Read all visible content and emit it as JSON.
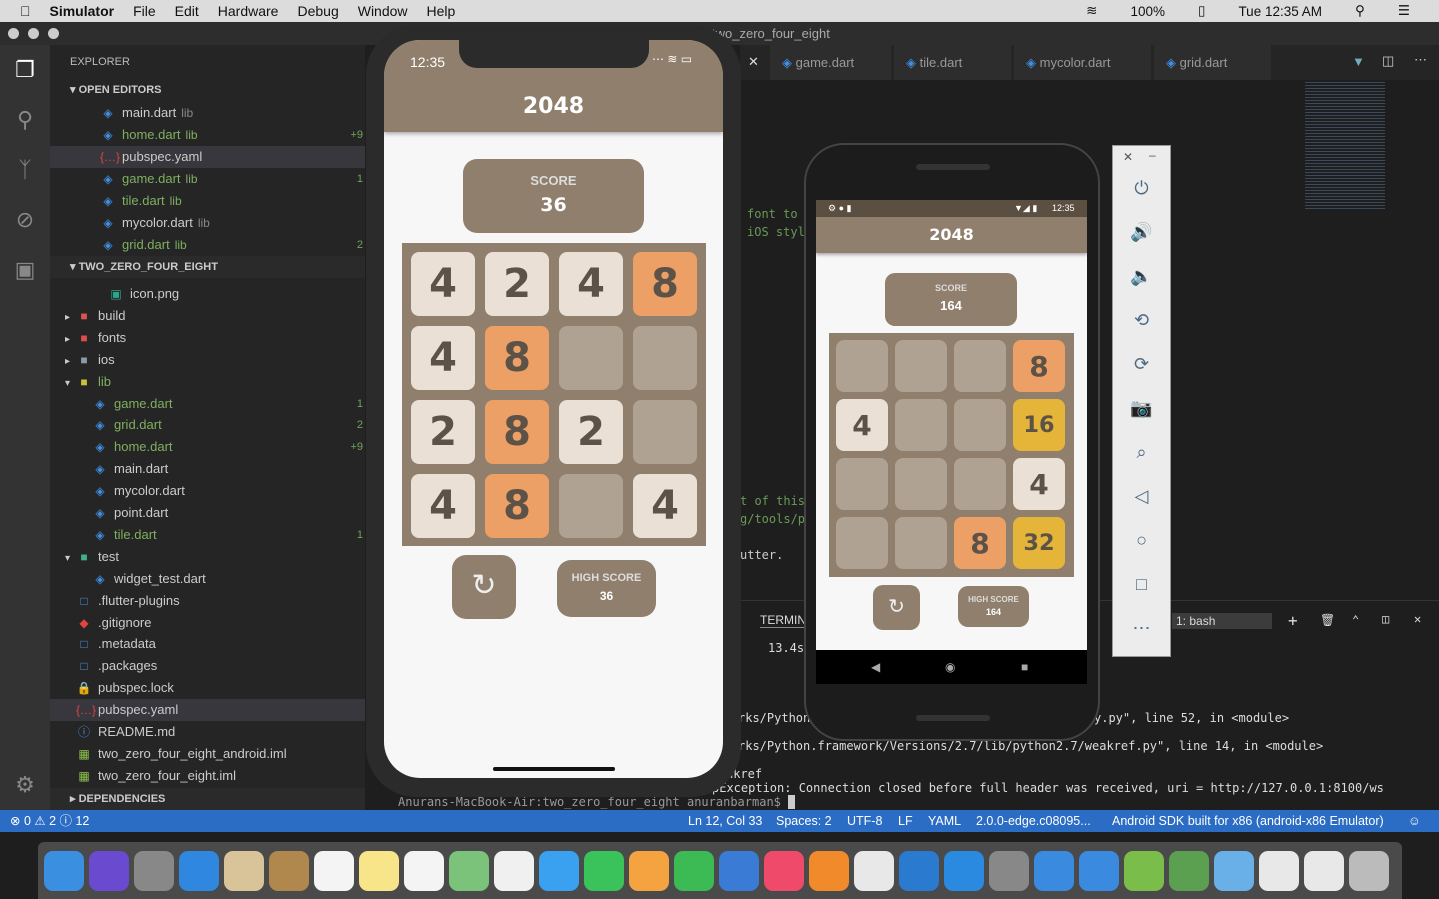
{
  "menubar": {
    "app": "Simulator",
    "items": [
      "File",
      "Edit",
      "Hardware",
      "Debug",
      "Window",
      "Help"
    ],
    "battery": "100%",
    "clock": "Tue 12:35 AM"
  },
  "window_title": "two_zero_four_eight",
  "explorer": {
    "title": "EXPLORER",
    "open_editors_label": "OPEN EDITORS",
    "project_label": "TWO_ZERO_FOUR_EIGHT",
    "dependencies_label": "DEPENDENCIES",
    "open_editors": [
      {
        "name": "main.dart",
        "hint": "lib",
        "icon": "dart",
        "deco": ""
      },
      {
        "name": "home.dart",
        "hint": "lib",
        "icon": "dart",
        "deco": "+9",
        "modified": true
      },
      {
        "name": "pubspec.yaml",
        "hint": "",
        "icon": "yaml",
        "deco": "",
        "selected": true
      },
      {
        "name": "game.dart",
        "hint": "lib",
        "icon": "dart",
        "deco": "1",
        "modified": true
      },
      {
        "name": "tile.dart",
        "hint": "lib",
        "icon": "dart",
        "deco": "",
        "modified": true
      },
      {
        "name": "mycolor.dart",
        "hint": "lib",
        "icon": "dart",
        "deco": ""
      },
      {
        "name": "grid.dart",
        "hint": "lib",
        "icon": "dart",
        "deco": "2",
        "modified": true
      }
    ],
    "tree": [
      {
        "name": "icon.png",
        "indent": 3,
        "icon": "image"
      },
      {
        "name": "build",
        "indent": 1,
        "icon": "folder-build",
        "arrow": "right"
      },
      {
        "name": "fonts",
        "indent": 1,
        "icon": "folder-fonts",
        "arrow": "right"
      },
      {
        "name": "ios",
        "indent": 1,
        "icon": "folder",
        "arrow": "right"
      },
      {
        "name": "lib",
        "indent": 1,
        "icon": "folder-open",
        "arrow": "down",
        "modified": true
      },
      {
        "name": "game.dart",
        "indent": 2,
        "icon": "dart",
        "deco": "1",
        "modified": true
      },
      {
        "name": "grid.dart",
        "indent": 2,
        "icon": "dart",
        "deco": "2",
        "modified": true
      },
      {
        "name": "home.dart",
        "indent": 2,
        "icon": "dart",
        "deco": "+9",
        "modified": true
      },
      {
        "name": "main.dart",
        "indent": 2,
        "icon": "dart"
      },
      {
        "name": "mycolor.dart",
        "indent": 2,
        "icon": "dart"
      },
      {
        "name": "point.dart",
        "indent": 2,
        "icon": "dart"
      },
      {
        "name": "tile.dart",
        "indent": 2,
        "icon": "dart",
        "deco": "1",
        "modified": true
      },
      {
        "name": "test",
        "indent": 1,
        "icon": "folder-test",
        "arrow": "down"
      },
      {
        "name": "widget_test.dart",
        "indent": 2,
        "icon": "dart"
      },
      {
        "name": ".flutter-plugins",
        "indent": 1,
        "icon": "file"
      },
      {
        "name": ".gitignore",
        "indent": 1,
        "icon": "git"
      },
      {
        "name": ".metadata",
        "indent": 1,
        "icon": "file"
      },
      {
        "name": ".packages",
        "indent": 1,
        "icon": "file"
      },
      {
        "name": "pubspec.lock",
        "indent": 1,
        "icon": "lock"
      },
      {
        "name": "pubspec.yaml",
        "indent": 1,
        "icon": "yaml",
        "selected": true
      },
      {
        "name": "README.md",
        "indent": 1,
        "icon": "info"
      },
      {
        "name": "two_zero_four_eight_android.iml",
        "indent": 1,
        "icon": "xml"
      },
      {
        "name": "two_zero_four_eight.iml",
        "indent": 1,
        "icon": "xml"
      }
    ]
  },
  "tabs": [
    "game.dart",
    "tile.dart",
    "mycolor.dart",
    "grid.dart"
  ],
  "editor_fragments": [
    "font to",
    "iOS styl",
    "t of this",
    "g/tools/p",
    "utter."
  ],
  "terminal": {
    "tab_label": "TERMIN",
    "shell_select": "1: bash",
    "lines": [
      "13.4s",
      "rks/Python",
      "y.py\", line 52, in <module>",
      "rks/Python.framework/Versions/2.7/lib/python2.7/weakref.py\", line 14, in <module>",
      "akref",
      "pException: Connection closed before full header was received, uri = http://127.0.0.1:8100/ws",
      "Anurans-MacBook-Air:two_zero_four_eight anuranbarman$"
    ]
  },
  "statusbar": {
    "errors": "0",
    "warnings": "2",
    "infos": "12",
    "position": "Ln 12, Col 33",
    "spaces": "Spaces: 2",
    "encoding": "UTF-8",
    "eol": "LF",
    "language": "YAML",
    "sdk": "2.0.0-edge.c08095...",
    "device": "Android SDK built for x86 (android-x86 Emulator)"
  },
  "iphone": {
    "time": "12:35",
    "title": "2048",
    "score_label": "SCORE",
    "score": "36",
    "high_score_label": "HIGH SCORE",
    "high_score": "36",
    "grid": [
      [
        4,
        2,
        4,
        8
      ],
      [
        4,
        8,
        0,
        0
      ],
      [
        2,
        8,
        2,
        0
      ],
      [
        4,
        8,
        0,
        4
      ]
    ]
  },
  "android": {
    "time": "12:35",
    "title": "2048",
    "score_label": "SCORE",
    "score": "164",
    "high_score_label": "HIGH SCORE",
    "high_score": "164",
    "grid": [
      [
        0,
        0,
        0,
        8
      ],
      [
        4,
        0,
        0,
        16
      ],
      [
        0,
        0,
        0,
        4
      ],
      [
        0,
        0,
        8,
        32
      ]
    ]
  },
  "emulator_toolbar": [
    "power",
    "volume-up",
    "volume-down",
    "rotate-left",
    "rotate-right",
    "camera",
    "zoom",
    "back",
    "home",
    "overview",
    "more"
  ],
  "tile_colors": {
    "0": "#b0a293",
    "2": "#ebe0d6",
    "4": "#ebe0d6",
    "8": "#eda066",
    "16": "#e5b53a",
    "32": "#e5b53a"
  },
  "colors": {
    "app_brown": "#8f7f6c",
    "status_bar": "#2b6cc4"
  },
  "dock": [
    "finder",
    "siri",
    "launchpad",
    "safari",
    "mail-stamp",
    "contacts",
    "calendar",
    "notes",
    "reminders",
    "maps",
    "photos",
    "messages",
    "facetime",
    "pages",
    "numbers",
    "keynote",
    "itunes",
    "ibooks",
    "chrome",
    "vscode",
    "app-store",
    "system-preferences",
    "xcode",
    "simulator",
    "android-studio",
    "android-file",
    "folder",
    "preview",
    "preview2",
    "trash"
  ]
}
